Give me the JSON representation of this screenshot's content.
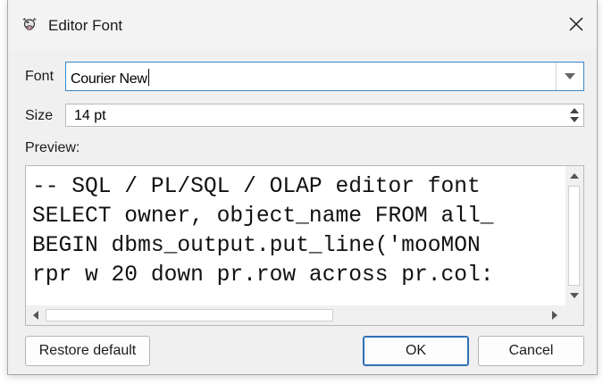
{
  "window": {
    "title": "Editor Font",
    "app_icon": "cow-icon"
  },
  "font": {
    "label": "Font",
    "value": "Courier New"
  },
  "size": {
    "label": "Size",
    "value": "14  pt"
  },
  "preview": {
    "label": "Preview:",
    "lines": [
      "-- SQL / PL/SQL / OLAP editor font",
      "SELECT owner, object_name FROM all_",
      "BEGIN dbms_output.put_line('mooMON",
      "rpr w 20 down pr.row across pr.col:"
    ]
  },
  "buttons": {
    "restore": "Restore default",
    "ok": "OK",
    "cancel": "Cancel"
  },
  "colors": {
    "focus_border": "#3a87c9",
    "default_button_border": "#2f6fb5",
    "dialog_bg": "#f0f0f0"
  }
}
